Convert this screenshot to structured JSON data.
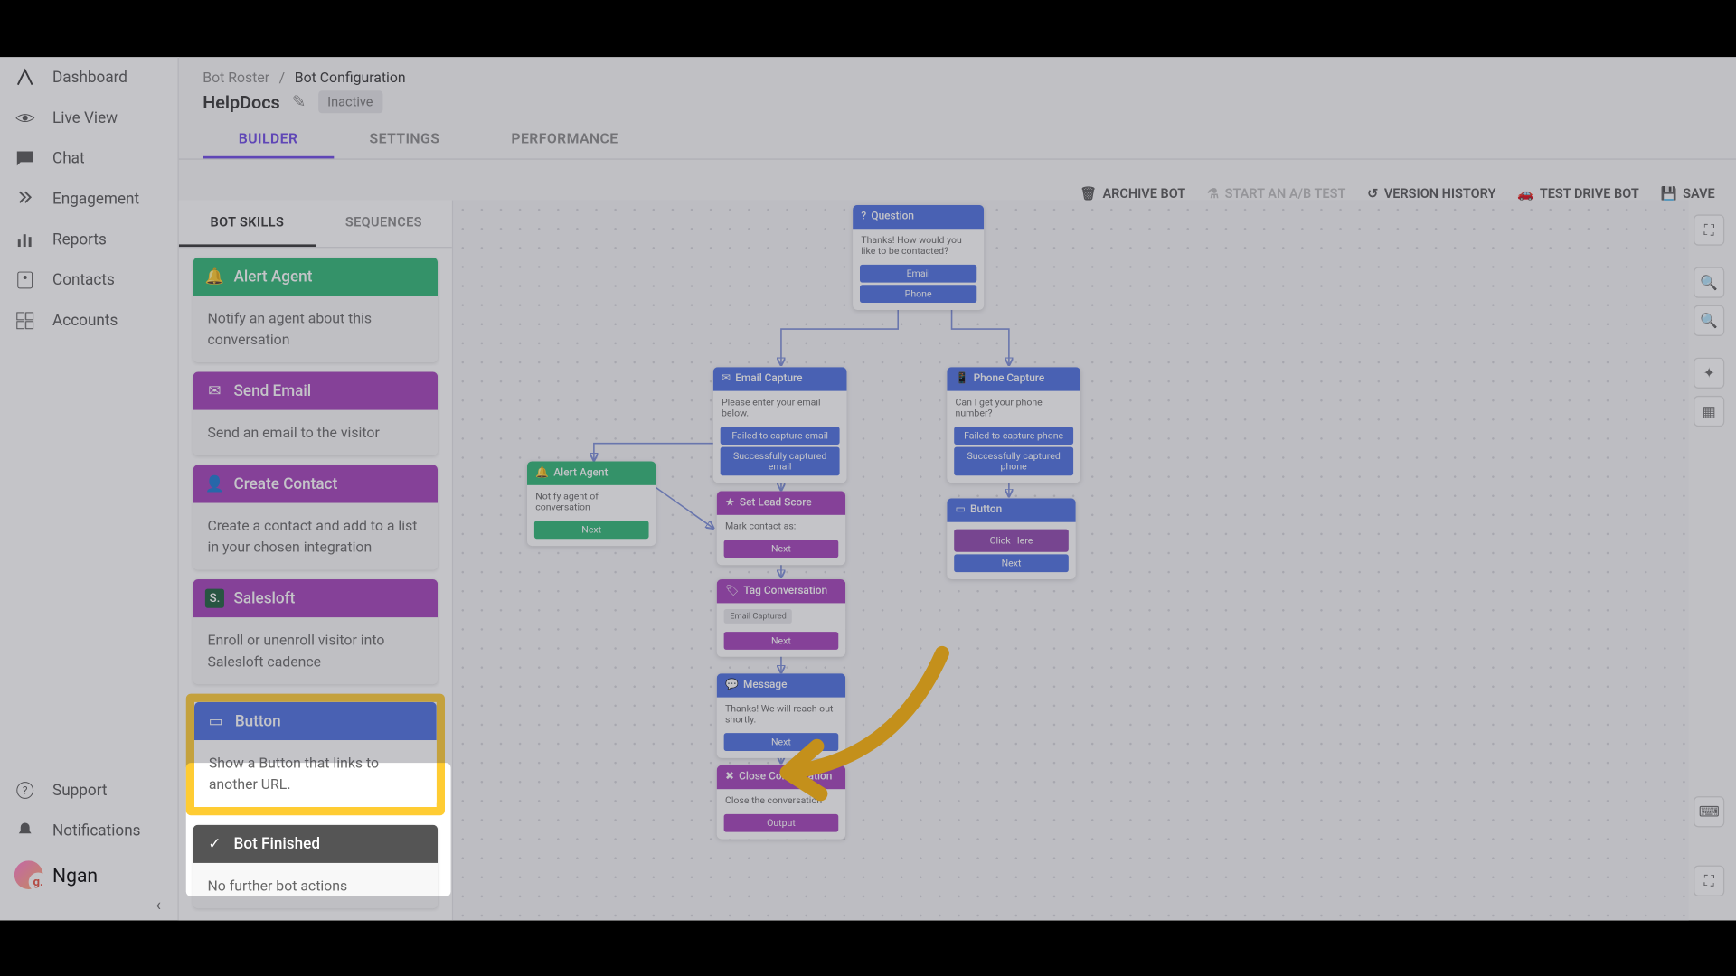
{
  "sidebar": {
    "items": [
      {
        "label": "Dashboard",
        "icon": "logo"
      },
      {
        "label": "Live View",
        "icon": "eye"
      },
      {
        "label": "Chat",
        "icon": "chat"
      },
      {
        "label": "Engagement",
        "icon": "engagement"
      },
      {
        "label": "Reports",
        "icon": "reports"
      },
      {
        "label": "Contacts",
        "icon": "contacts"
      },
      {
        "label": "Accounts",
        "icon": "accounts"
      }
    ],
    "bottom": [
      {
        "label": "Support",
        "icon": "help"
      },
      {
        "label": "Notifications",
        "icon": "bell"
      }
    ],
    "user": {
      "name": "Ngan",
      "badge": "g."
    }
  },
  "breadcrumb": {
    "root": "Bot Roster",
    "current": "Bot Configuration"
  },
  "bot": {
    "name": "HelpDocs",
    "status": "Inactive"
  },
  "tabs": [
    {
      "label": "BUILDER",
      "active": true
    },
    {
      "label": "SETTINGS",
      "active": false
    },
    {
      "label": "PERFORMANCE",
      "active": false
    }
  ],
  "actions": {
    "archive": "ARCHIVE BOT",
    "abtest": "START AN A/B TEST",
    "history": "VERSION HISTORY",
    "testdrive": "TEST DRIVE BOT",
    "save": "SAVE"
  },
  "skills_tabs": [
    {
      "label": "BOT SKILLS",
      "active": true
    },
    {
      "label": "SEQUENCES",
      "active": false
    }
  ],
  "skills": [
    {
      "title": "Alert Agent",
      "desc": "Notify an agent about this conversation",
      "color": "green",
      "icon": "bell"
    },
    {
      "title": "Send Email",
      "desc": "Send an email to the visitor",
      "color": "purple",
      "icon": "mail"
    },
    {
      "title": "Create Contact",
      "desc": "Create a contact and add to a list in your chosen integration",
      "color": "purple",
      "icon": "person-add"
    },
    {
      "title": "Salesloft",
      "desc": "Enroll or unenroll visitor into Salesloft cadence",
      "color": "purple",
      "icon": "salesloft"
    },
    {
      "title": "Button",
      "desc": "Show a Button that links to another URL.",
      "color": "blue",
      "icon": "button",
      "highlighted": true
    },
    {
      "title": "Bot Finished",
      "desc": "No further bot actions",
      "color": "dark",
      "icon": "check"
    }
  ],
  "flow": {
    "question": {
      "title": "Question",
      "body": "Thanks! How would you like to be contacted?",
      "opts": [
        "Email",
        "Phone"
      ]
    },
    "email_capture": {
      "title": "Email Capture",
      "body": "Please enter your email below.",
      "btns": [
        "Failed to capture email",
        "Successfully captured email"
      ]
    },
    "phone_capture": {
      "title": "Phone Capture",
      "body": "Can I get your phone number?",
      "btns": [
        "Failed to capture phone",
        "Successfully captured phone"
      ]
    },
    "alert_agent": {
      "title": "Alert Agent",
      "body": "Notify agent of conversation",
      "btn": "Next"
    },
    "set_lead": {
      "title": "Set Lead Score",
      "body": "Mark contact as:",
      "btn": "Next"
    },
    "tag_conv": {
      "title": "Tag Conversation",
      "tag": "Email Captured",
      "btn": "Next"
    },
    "message": {
      "title": "Message",
      "body": "Thanks! We will reach out shortly.",
      "btn": "Next"
    },
    "close_conv": {
      "title": "Close Conversation",
      "body": "Close the conversation",
      "btn": "Output"
    },
    "button_node": {
      "title": "Button",
      "btn1": "Click Here",
      "btn2": "Next"
    }
  }
}
